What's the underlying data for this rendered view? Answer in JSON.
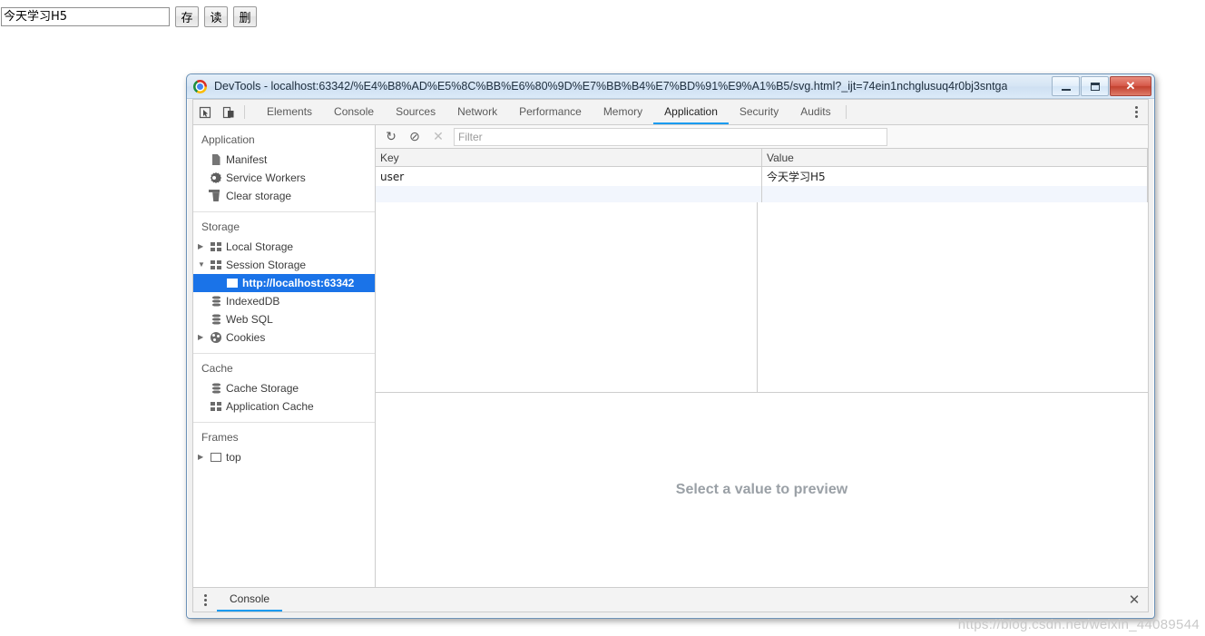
{
  "page_form": {
    "input_value": "今天学习H5",
    "input_placeholder": "",
    "buttons": [
      {
        "label": "存",
        "name": "save-button"
      },
      {
        "label": "读",
        "name": "read-button"
      },
      {
        "label": "删",
        "name": "delete-button"
      }
    ]
  },
  "window": {
    "title": "DevTools - localhost:63342/%E4%B8%AD%E5%8C%BB%E6%80%9D%E7%BB%B4%E7%BD%91%E9%A1%B5/svg.html?_ijt=74ein1nchglusuq4r0bj3sntga",
    "minimize_label": "Minimize",
    "maximize_label": "Maximize",
    "close_label": "✕"
  },
  "devtools": {
    "inspect_icon": "inspect-element-icon",
    "device_icon": "device-toolbar-icon",
    "tabs": [
      {
        "label": "Elements",
        "active": false
      },
      {
        "label": "Console",
        "active": false
      },
      {
        "label": "Sources",
        "active": false
      },
      {
        "label": "Network",
        "active": false
      },
      {
        "label": "Performance",
        "active": false
      },
      {
        "label": "Memory",
        "active": false
      },
      {
        "label": "Application",
        "active": true
      },
      {
        "label": "Security",
        "active": false
      },
      {
        "label": "Audits",
        "active": false
      }
    ],
    "more_menu": "more-tools-icon",
    "accent_color": "#1a9bf0"
  },
  "sidebar": {
    "groups": [
      {
        "title": "Application",
        "items": [
          {
            "label": "Manifest",
            "icon": "document-icon",
            "arrow": "none",
            "indent": false,
            "selected": false
          },
          {
            "label": "Service Workers",
            "icon": "gear-icon",
            "arrow": "none",
            "indent": false,
            "selected": false
          },
          {
            "label": "Clear storage",
            "icon": "trash-icon",
            "arrow": "none",
            "indent": false,
            "selected": false
          }
        ]
      },
      {
        "title": "Storage",
        "items": [
          {
            "label": "Local Storage",
            "icon": "grid-icon",
            "arrow": "right",
            "indent": false,
            "selected": false
          },
          {
            "label": "Session Storage",
            "icon": "grid-icon",
            "arrow": "down",
            "indent": false,
            "selected": false
          },
          {
            "label": "http://localhost:63342",
            "icon": "grid-icon",
            "arrow": "none",
            "indent": true,
            "selected": true
          },
          {
            "label": "IndexedDB",
            "icon": "database-icon",
            "arrow": "none",
            "indent": false,
            "selected": false
          },
          {
            "label": "Web SQL",
            "icon": "database-icon",
            "arrow": "none",
            "indent": false,
            "selected": false
          },
          {
            "label": "Cookies",
            "icon": "cookie-icon",
            "arrow": "right",
            "indent": false,
            "selected": false
          }
        ]
      },
      {
        "title": "Cache",
        "items": [
          {
            "label": "Cache Storage",
            "icon": "database-icon",
            "arrow": "none",
            "indent": false,
            "selected": false
          },
          {
            "label": "Application Cache",
            "icon": "grid-icon",
            "arrow": "none",
            "indent": false,
            "selected": false
          }
        ]
      },
      {
        "title": "Frames",
        "items": [
          {
            "label": "top",
            "icon": "frame-icon",
            "arrow": "right",
            "indent": false,
            "selected": false
          }
        ]
      }
    ],
    "selection_color": "#1a73e8"
  },
  "storage_toolbar": {
    "refresh_icon": "refresh-icon",
    "clear_icon": "clear-all-icon",
    "delete_icon": "delete-selected-icon",
    "filter_placeholder": "Filter",
    "filter_value": ""
  },
  "storage_table": {
    "columns": [
      "Key",
      "Value"
    ],
    "rows": [
      {
        "key": "user",
        "value": "今天学习H5"
      }
    ]
  },
  "preview": {
    "message": "Select a value to preview"
  },
  "drawer": {
    "menu_icon": "drawer-menu-icon",
    "tab_label": "Console",
    "close_label": "✕"
  },
  "watermark": {
    "text": "https://blog.csdn.net/weixin_44089544"
  }
}
